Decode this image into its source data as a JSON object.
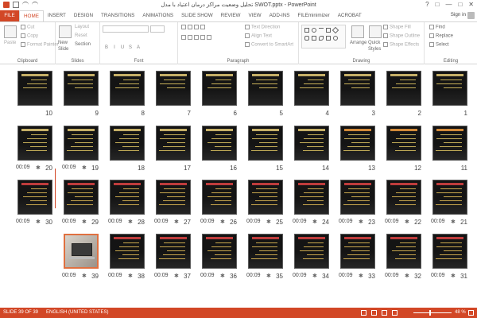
{
  "window": {
    "title": "تحلیل وضعیت مراکز درمان اعتیاد با مدل SWOT.pptx - PowerPoint",
    "controls": [
      "?",
      "□",
      "—",
      "□",
      "✕"
    ]
  },
  "tabs": [
    "FILE",
    "HOME",
    "INSERT",
    "DESIGN",
    "TRANSITIONS",
    "ANIMATIONS",
    "SLIDE SHOW",
    "REVIEW",
    "VIEW",
    "ADD-INS",
    "FILEminimizer",
    "ACROBAT"
  ],
  "active_tab": "HOME",
  "account": {
    "signin_label": "Sign in"
  },
  "ribbon": {
    "clipboard": {
      "label": "Clipboard",
      "paste": "Paste",
      "cut": "Cut",
      "copy": "Copy",
      "format_painter": "Format Painter"
    },
    "slides": {
      "label": "Slides",
      "new_slide_1": "New",
      "new_slide_2": "Slide",
      "layout": "Layout",
      "reset": "Reset",
      "section": "Section"
    },
    "font": {
      "label": "Font"
    },
    "paragraph": {
      "label": "Paragraph",
      "text_direction": "Text Direction",
      "align_text": "Align Text",
      "convert": "Convert to SmartArt"
    },
    "drawing": {
      "label": "Drawing",
      "arrange": "Arrange",
      "quick_styles_1": "Quick",
      "quick_styles_2": "Styles",
      "shape_fill": "Shape Fill",
      "shape_outline": "Shape Outline",
      "shape_effects": "Shape Effects"
    },
    "editing": {
      "label": "Editing",
      "find": "Find",
      "replace": "Replace",
      "select": "Select"
    }
  },
  "slides_row1": [
    {
      "num": "10",
      "time": ""
    },
    {
      "num": "9",
      "time": ""
    },
    {
      "num": "8",
      "time": ""
    },
    {
      "num": "7",
      "time": ""
    },
    {
      "num": "6",
      "time": ""
    },
    {
      "num": "5",
      "time": ""
    },
    {
      "num": "4",
      "time": ""
    },
    {
      "num": "3",
      "time": ""
    },
    {
      "num": "2",
      "time": ""
    },
    {
      "num": "1",
      "time": ""
    }
  ],
  "slides_row2": [
    {
      "num": "20",
      "time": "00:09"
    },
    {
      "num": "19",
      "time": "00:09"
    },
    {
      "num": "18",
      "time": ""
    },
    {
      "num": "17",
      "time": ""
    },
    {
      "num": "16",
      "time": ""
    },
    {
      "num": "15",
      "time": ""
    },
    {
      "num": "14",
      "time": ""
    },
    {
      "num": "13",
      "time": ""
    },
    {
      "num": "12",
      "time": ""
    },
    {
      "num": "11",
      "time": ""
    }
  ],
  "slides_row3": [
    {
      "num": "30",
      "time": "00:09"
    },
    {
      "num": "29",
      "time": "00:09"
    },
    {
      "num": "28",
      "time": "00:09"
    },
    {
      "num": "27",
      "time": "00:09"
    },
    {
      "num": "26",
      "time": "00:09"
    },
    {
      "num": "25",
      "time": "00:09"
    },
    {
      "num": "24",
      "time": "00:09"
    },
    {
      "num": "23",
      "time": "00:09"
    },
    {
      "num": "22",
      "time": "00:09"
    },
    {
      "num": "21",
      "time": "00:09"
    }
  ],
  "slides_row4": [
    {
      "num": "39",
      "time": "00:09"
    },
    {
      "num": "38",
      "time": "00:09"
    },
    {
      "num": "37",
      "time": "00:09"
    },
    {
      "num": "36",
      "time": "00:09"
    },
    {
      "num": "35",
      "time": "00:09"
    },
    {
      "num": "34",
      "time": "00:09"
    },
    {
      "num": "33",
      "time": "00:09"
    },
    {
      "num": "32",
      "time": "00:09"
    },
    {
      "num": "31",
      "time": "00:09"
    }
  ],
  "status": {
    "slide_info": "SLIDE 39 OF 39",
    "language": "ENGLISH (UNITED STATES)",
    "zoom": "48 %"
  },
  "colors": {
    "accent": "#d24726",
    "slide_bg": "#141414"
  }
}
